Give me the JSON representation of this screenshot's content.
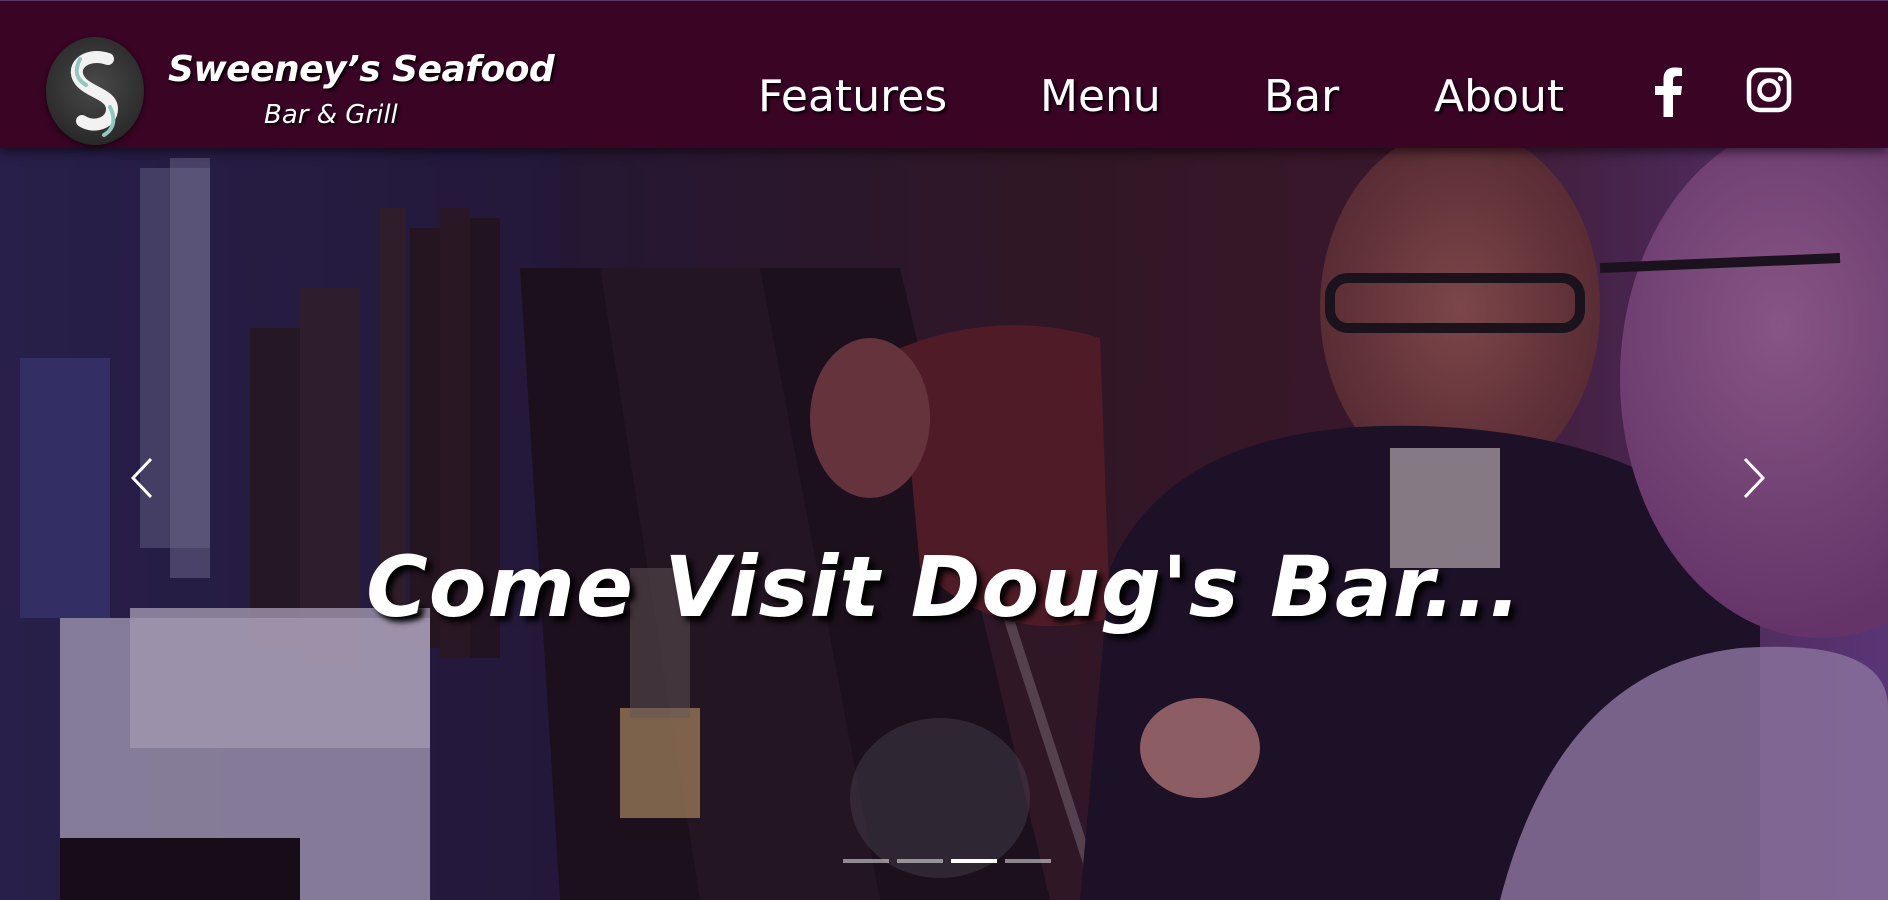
{
  "brand": {
    "title": "Sweeney’s Seafood",
    "subtitle": "Bar & Grill",
    "logo_icon": "s-logo-icon"
  },
  "nav": {
    "items": [
      {
        "label": "Features"
      },
      {
        "label": "Menu"
      },
      {
        "label": "Bar"
      },
      {
        "label": "About"
      }
    ],
    "social": [
      {
        "icon": "facebook-icon"
      },
      {
        "icon": "instagram-icon"
      }
    ]
  },
  "hero": {
    "caption": "Come Visit Doug's Bar...",
    "slide_count": 4,
    "active_slide": 3
  },
  "colors": {
    "navbar": "#3a0425",
    "text": "#ffffff"
  }
}
